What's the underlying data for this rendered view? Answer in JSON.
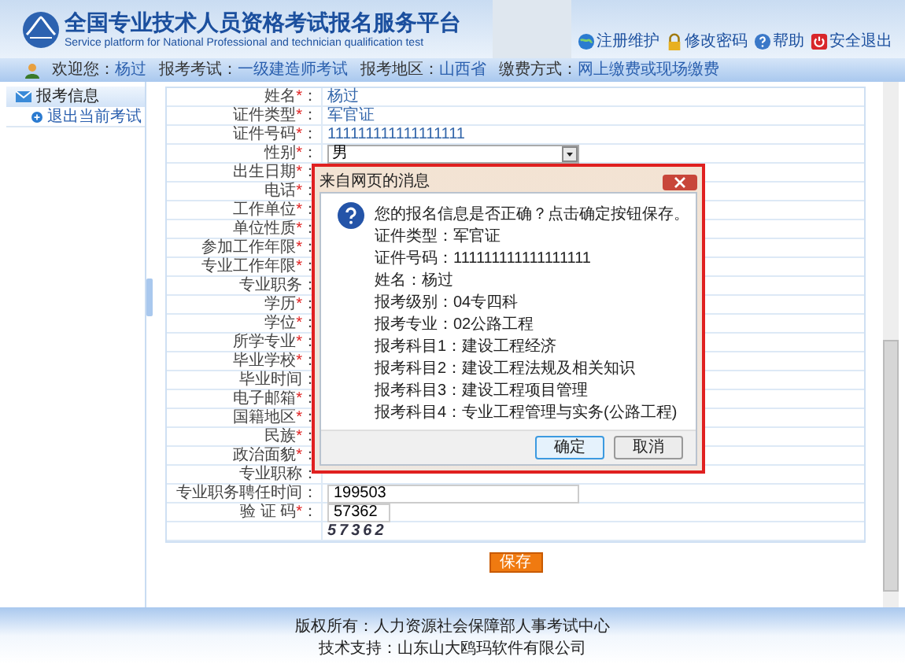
{
  "header": {
    "title": "全国专业技术人员资格考试报名服务平台",
    "subtitle": "Service platform for National Professional and technician qualification test",
    "links": [
      {
        "kind": "globe",
        "label": "注册维护"
      },
      {
        "kind": "lock",
        "label": "修改密码"
      },
      {
        "kind": "help",
        "label": "帮助"
      },
      {
        "kind": "exit",
        "label": "安全退出"
      }
    ]
  },
  "info_bar": [
    {
      "label": "欢迎您：",
      "value": "杨过"
    },
    {
      "label": "报考考试：",
      "value": "一级建造师考试"
    },
    {
      "label": "报考地区：",
      "value": "山西省"
    },
    {
      "label": "缴费方式：",
      "value": "网上缴费或现场缴费"
    }
  ],
  "sidebar": {
    "title": "报考信息",
    "items": [
      {
        "label": "退出当前考试"
      }
    ]
  },
  "form": {
    "rows": [
      {
        "kind": "text",
        "label": "姓名",
        "mark": "*",
        "suffix": "：",
        "value": "杨过"
      },
      {
        "kind": "text",
        "label": "证件类型",
        "mark": "*",
        "suffix": "：",
        "value": "军官证"
      },
      {
        "kind": "text",
        "label": "证件号码",
        "mark": "*",
        "suffix": "：",
        "value": "111111111111111111"
      },
      {
        "kind": "select",
        "label": "性别",
        "mark": "*",
        "suffix": "：",
        "value": "男"
      },
      {
        "kind": "empty",
        "label": "出生日期",
        "mark": "*",
        "suffix": "："
      },
      {
        "kind": "empty",
        "label": "电话",
        "mark": "*",
        "suffix": "："
      },
      {
        "kind": "empty",
        "label": "工作单位",
        "mark": "*",
        "suffix": "："
      },
      {
        "kind": "empty",
        "label": "单位性质",
        "mark": "*",
        "suffix": "："
      },
      {
        "kind": "empty",
        "label": "参加工作年限",
        "mark": "*",
        "suffix": "："
      },
      {
        "kind": "empty",
        "label": "专业工作年限",
        "mark": "*",
        "suffix": "："
      },
      {
        "kind": "empty",
        "label": "专业职务："
      },
      {
        "kind": "empty",
        "label": "学历",
        "mark": "*",
        "suffix": "："
      },
      {
        "kind": "empty",
        "label": "学位",
        "mark": "*",
        "suffix": "："
      },
      {
        "kind": "empty",
        "label": "所学专业",
        "mark": "*",
        "suffix": "："
      },
      {
        "kind": "empty",
        "label": "毕业学校",
        "mark": "*",
        "suffix": "："
      },
      {
        "kind": "empty",
        "label": "毕业时间："
      },
      {
        "kind": "empty",
        "label": "电子邮箱",
        "mark": "*",
        "suffix": "："
      },
      {
        "kind": "empty",
        "label": "国籍地区",
        "mark": "*",
        "suffix": "："
      },
      {
        "kind": "empty",
        "label": "民族",
        "mark": "*",
        "suffix": "："
      },
      {
        "kind": "empty",
        "label": "政治面貌",
        "mark": "*",
        "suffix": "："
      },
      {
        "kind": "empty",
        "label": "专业职称："
      },
      {
        "kind": "input",
        "label": "专业职务聘任时间：",
        "value": "199503"
      },
      {
        "kind": "code",
        "label": "验 证 码",
        "mark": "*",
        "suffix": "：",
        "value": "57362"
      },
      {
        "kind": "captcha",
        "value": "57362"
      }
    ],
    "save_button": "保存"
  },
  "dialog": {
    "title": "来自网页的消息",
    "lines": [
      "您的报名信息是否正确？点击确定按钮保存。",
      "证件类型：军官证",
      "证件号码：111111111111111111",
      "姓名：杨过",
      "报考级别：04专四科",
      "报考专业：02公路工程",
      "报考科目1：建设工程经济",
      "报考科目2：建设工程法规及相关知识",
      "报考科目3：建设工程项目管理",
      "报考科目4：专业工程管理与实务(公路工程)"
    ],
    "buttons": [
      {
        "label": "确定",
        "selected": true
      },
      {
        "label": "取消",
        "selected": false
      }
    ]
  },
  "footer": [
    "版权所有：人力资源社会保障部人事考试中心",
    "技术支持：山东山大鸥玛软件有限公司"
  ]
}
